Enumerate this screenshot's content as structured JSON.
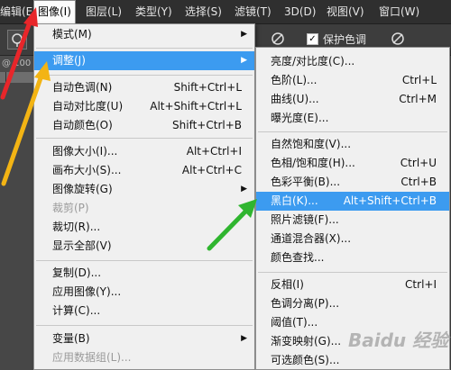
{
  "menubar": {
    "items": [
      {
        "label": "编辑(E)",
        "name": "menu-edit"
      },
      {
        "label": "图像(I)",
        "name": "menu-image"
      },
      {
        "label": "图层(L)",
        "name": "menu-layer"
      },
      {
        "label": "类型(Y)",
        "name": "menu-type"
      },
      {
        "label": "选择(S)",
        "name": "menu-select"
      },
      {
        "label": "滤镜(T)",
        "name": "menu-filter"
      },
      {
        "label": "3D(D)",
        "name": "menu-3d"
      },
      {
        "label": "视图(V)",
        "name": "menu-view"
      },
      {
        "label": "窗口(W)",
        "name": "menu-window"
      }
    ]
  },
  "options": {
    "protect_tone_label": "保护色调",
    "protect_tone_checked": "✓"
  },
  "document": {
    "tab_label": "@ 100"
  },
  "image_menu": {
    "items": [
      {
        "label": "模式(M)",
        "shortcut": "",
        "submenu": true
      },
      {
        "label": "调整(J)",
        "shortcut": "",
        "submenu": true,
        "highlighted": true
      },
      {
        "label": "自动色调(N)",
        "shortcut": "Shift+Ctrl+L"
      },
      {
        "label": "自动对比度(U)",
        "shortcut": "Alt+Shift+Ctrl+L"
      },
      {
        "label": "自动颜色(O)",
        "shortcut": "Shift+Ctrl+B"
      },
      {
        "label": "图像大小(I)...",
        "shortcut": "Alt+Ctrl+I"
      },
      {
        "label": "画布大小(S)...",
        "shortcut": "Alt+Ctrl+C"
      },
      {
        "label": "图像旋转(G)",
        "shortcut": "",
        "submenu": true
      },
      {
        "label": "裁剪(P)",
        "shortcut": "",
        "disabled": true
      },
      {
        "label": "裁切(R)...",
        "shortcut": ""
      },
      {
        "label": "显示全部(V)",
        "shortcut": ""
      },
      {
        "label": "复制(D)...",
        "shortcut": ""
      },
      {
        "label": "应用图像(Y)...",
        "shortcut": ""
      },
      {
        "label": "计算(C)...",
        "shortcut": ""
      },
      {
        "label": "变量(B)",
        "shortcut": "",
        "submenu": true
      },
      {
        "label": "应用数据组(L)...",
        "shortcut": "",
        "disabled": true
      }
    ]
  },
  "adjust_menu": {
    "items": [
      {
        "label": "亮度/对比度(C)...",
        "shortcut": ""
      },
      {
        "label": "色阶(L)...",
        "shortcut": "Ctrl+L"
      },
      {
        "label": "曲线(U)...",
        "shortcut": "Ctrl+M"
      },
      {
        "label": "曝光度(E)...",
        "shortcut": ""
      },
      {
        "label": "自然饱和度(V)...",
        "shortcut": ""
      },
      {
        "label": "色相/饱和度(H)...",
        "shortcut": "Ctrl+U"
      },
      {
        "label": "色彩平衡(B)...",
        "shortcut": "Ctrl+B"
      },
      {
        "label": "黑白(K)...",
        "shortcut": "Alt+Shift+Ctrl+B",
        "highlighted": true
      },
      {
        "label": "照片滤镜(F)...",
        "shortcut": ""
      },
      {
        "label": "通道混合器(X)...",
        "shortcut": ""
      },
      {
        "label": "颜色查找...",
        "shortcut": ""
      },
      {
        "label": "反相(I)",
        "shortcut": "Ctrl+I"
      },
      {
        "label": "色调分离(P)...",
        "shortcut": ""
      },
      {
        "label": "阈值(T)...",
        "shortcut": ""
      },
      {
        "label": "渐变映射(G)...",
        "shortcut": ""
      },
      {
        "label": "可选颜色(S)...",
        "shortcut": ""
      }
    ]
  },
  "colors": {
    "highlight": "#3c9bf0",
    "arrow_red": "#e8262a",
    "arrow_yellow": "#f3b414",
    "arrow_green": "#2fb52f"
  },
  "watermark": "Baidu 经验"
}
